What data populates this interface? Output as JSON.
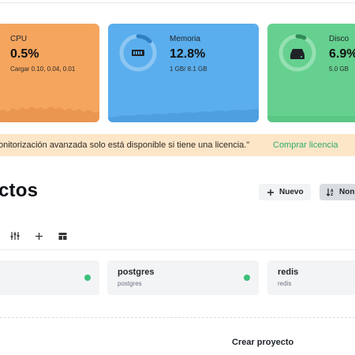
{
  "colors": {
    "cpu_card": "#f5a55e",
    "memory_card": "#5aaeed",
    "disk_card": "#65d08f",
    "banner_bg": "#fde6c8",
    "link": "#2eaa6b",
    "status_running": "#3cc07a"
  },
  "metrics": {
    "cpu": {
      "label": "CPU",
      "value": "0.5%",
      "sub": "Cargar 0.10, 0.04, 0.01"
    },
    "memory": {
      "label": "Memoria",
      "value": "12.8%",
      "sub": "1 GB/ 8.1 GB",
      "gauge_fraction": 0.128,
      "icon": "memory-chip-icon"
    },
    "disk": {
      "label": "Disco",
      "value": "6.9%",
      "sub": "5.0 GB",
      "gauge_fraction": 0.069,
      "icon": "hard-drive-icon"
    }
  },
  "banner": {
    "message": "onitorización avanzada solo está disponible si tiene una licencia.\"",
    "link": "Comprar licencia"
  },
  "projects_section": {
    "title": "ctos",
    "new_button": "Nuevo",
    "sort_button": "Non",
    "toolbar_icons": [
      "filter-sliders-icon",
      "plus-icon",
      "layout-icon"
    ]
  },
  "projects": [
    {
      "name": "",
      "sub": ""
    },
    {
      "name": "postgres",
      "sub": "postgres"
    },
    {
      "name": "redis",
      "sub": "redis"
    }
  ],
  "create_project": "Crear proyecto"
}
